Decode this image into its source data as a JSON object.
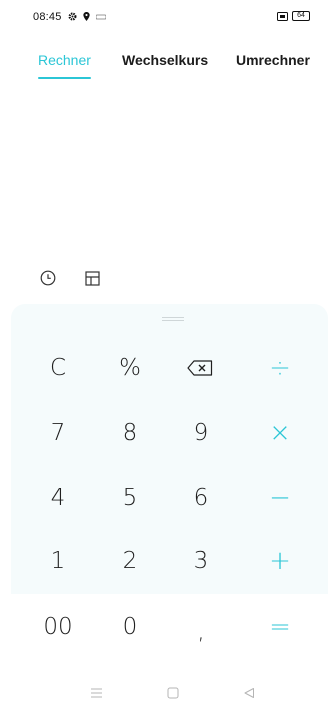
{
  "status": {
    "time": "08:45",
    "battery": "64"
  },
  "tabs": [
    {
      "label": "Rechner",
      "active": true
    },
    {
      "label": "Wechselkurs",
      "active": false
    },
    {
      "label": "Umrechner",
      "active": false
    }
  ],
  "tools": {
    "history_icon": "clock-icon",
    "scientific_icon": "layout-icon"
  },
  "keypad": {
    "rows": [
      [
        "C",
        "%",
        "backspace",
        "÷"
      ],
      [
        "7",
        "8",
        "9",
        "×"
      ],
      [
        "4",
        "5",
        "6",
        "−"
      ],
      [
        "1",
        "2",
        "3",
        "+"
      ],
      [
        "00",
        "0",
        ",",
        "="
      ]
    ]
  },
  "colors": {
    "accent": "#2bc6d6",
    "keypad_bg": "#f5fbfc"
  }
}
